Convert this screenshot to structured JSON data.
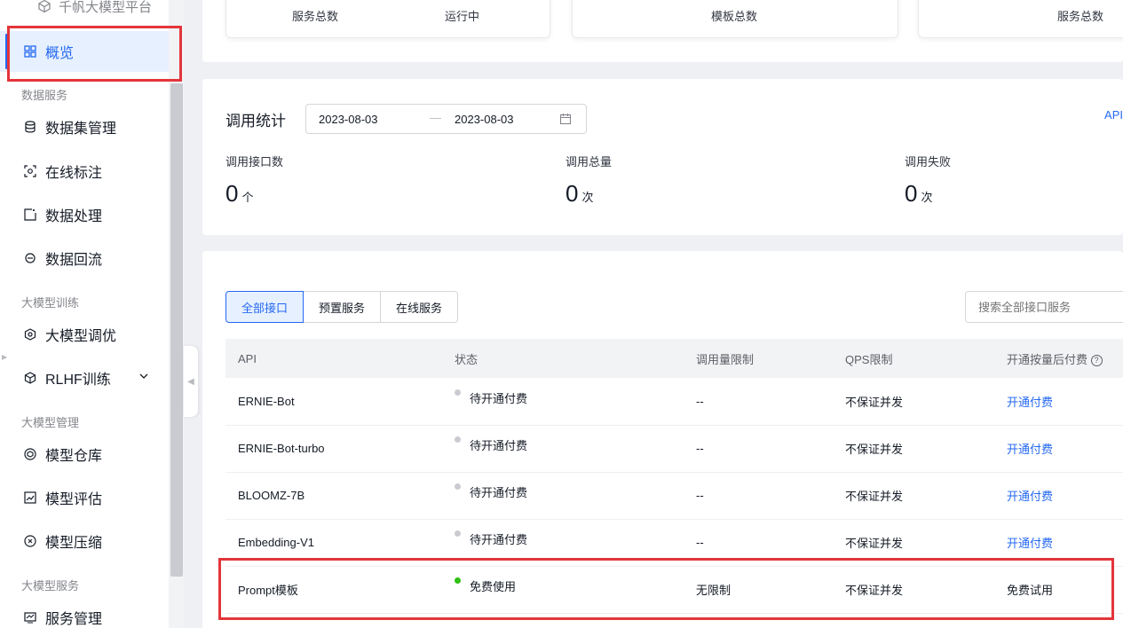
{
  "sidebar": {
    "brand": "千帆大模型平台",
    "active": "概览",
    "groups": [
      "数据服务",
      "大模型训练",
      "大模型管理",
      "大模型服务"
    ],
    "items": [
      "数据集管理",
      "在线标注",
      "数据处理",
      "数据回流",
      "大模型调优",
      "RLHF训练",
      "模型仓库",
      "模型评估",
      "模型压缩",
      "服务管理"
    ]
  },
  "top_stats": {
    "card1": [
      "服务总数",
      "运行中"
    ],
    "card2": "模板总数",
    "card3": "服务总数"
  },
  "call_stats": {
    "title": "调用统计",
    "date_start": "2023-08-03",
    "date_sep": "—",
    "date_end": "2023-08-03",
    "api_link": "API",
    "metrics": [
      {
        "label": "调用接口数",
        "value": "0",
        "unit": "个"
      },
      {
        "label": "调用总量",
        "value": "0",
        "unit": "次"
      },
      {
        "label": "调用失败",
        "value": "0",
        "unit": "次"
      }
    ]
  },
  "list": {
    "tabs": [
      "全部接口",
      "预置服务",
      "在线服务"
    ],
    "search_placeholder": "搜索全部接口服务",
    "columns": [
      "API",
      "状态",
      "调用量限制",
      "QPS限制",
      "开通按量后付费"
    ],
    "rows": [
      {
        "api": "ERNIE-Bot",
        "status": "待开通付费",
        "limit": "--",
        "qps": "不保证并发",
        "action": "开通付费"
      },
      {
        "api": "ERNIE-Bot-turbo",
        "status": "待开通付费",
        "limit": "--",
        "qps": "不保证并发",
        "action": "开通付费"
      },
      {
        "api": "BLOOMZ-7B",
        "status": "待开通付费",
        "limit": "--",
        "qps": "不保证并发",
        "action": "开通付费"
      },
      {
        "api": "Embedding-V1",
        "status": "待开通付费",
        "limit": "--",
        "qps": "不保证并发",
        "action": "开通付费"
      },
      {
        "api": "Prompt模板",
        "status": "免费使用",
        "limit": "无限制",
        "qps": "不保证并发",
        "action": "免费试用"
      }
    ]
  },
  "colors": {
    "accent": "#2468f2",
    "highlight": "#e3353a",
    "status_green": "#30bf13",
    "status_grey": "#c9cbd0"
  }
}
